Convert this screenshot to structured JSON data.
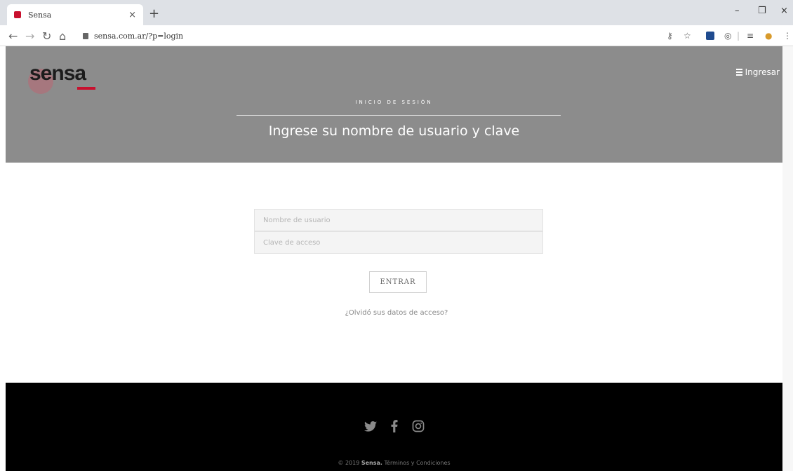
{
  "browser": {
    "tab_title": "Sensa",
    "tab_close": "×",
    "new_tab": "+",
    "url": "sensa.com.ar/?p=login",
    "minimize": "–",
    "maximize": "❐",
    "close": "×"
  },
  "header": {
    "logo_text": "sensa",
    "menu_label": "Ingresar",
    "section_label": "INICIO DE SESIÓN",
    "title": "Ingrese su nombre de usuario y clave"
  },
  "login": {
    "username_placeholder": "Nombre de usuario",
    "password_placeholder": "Clave de acceso",
    "submit_label": "ENTRAR",
    "forgot_label": "¿Olvidó sus datos de acceso?"
  },
  "footer": {
    "copyright_prefix": "© 2019",
    "brand": "Sensa.",
    "terms": "Términos y Condiciones",
    "social": [
      "twitter-icon",
      "facebook-icon",
      "instagram-icon"
    ]
  },
  "colors": {
    "header_bg": "#8c8c8c",
    "footer_bg": "#000000",
    "brand_red": "#c8102e"
  }
}
